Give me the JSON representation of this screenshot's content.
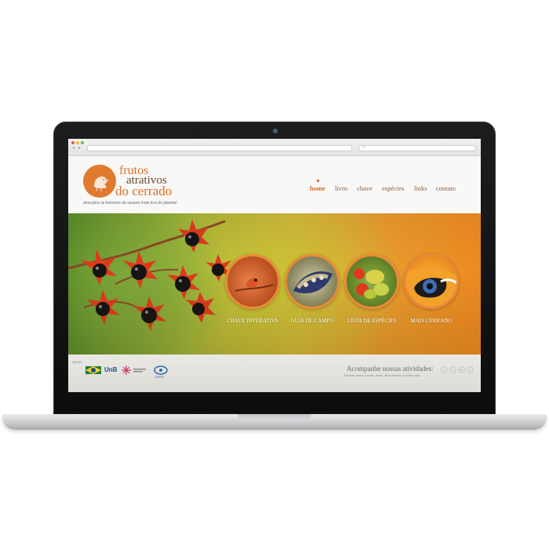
{
  "site": {
    "logo": {
      "word1": "frutos",
      "word2": "atrativos",
      "word3": "do cerrado"
    },
    "tagline": "descubra os tesouros da savana mais rica do planeta!",
    "nav": [
      "home",
      "livro",
      "chave",
      "espécies",
      "links",
      "contato"
    ],
    "active_nav": "home"
  },
  "hero": {
    "features": [
      {
        "label": "CHAVE INTERATIVA",
        "icon": "bird-on-branch-photo"
      },
      {
        "label": "GUIA DE CAMPO",
        "icon": "seed-pod-photo"
      },
      {
        "label": "LISTA DE ESPÉCIES",
        "icon": "fruits-photo"
      },
      {
        "label": "MAIS CERRADO",
        "icon": "toucan-photo"
      }
    ]
  },
  "footer": {
    "apoio_label": "Apoio:",
    "sponsors": {
      "unb": "UnB",
      "capes": "CAPES"
    },
    "follow_title": "Acompanhe nossas atividades:",
    "follow_sub": "Nossas redes sociais, fotos, descobertas & muito mais.",
    "social": [
      "twitter-icon",
      "facebook-icon",
      "youtube-icon",
      "flickr-icon"
    ]
  },
  "colors": {
    "accent_orange": "#e0671f",
    "logo_orange": "#de6f23",
    "nav_brown": "#8a5a3a"
  }
}
